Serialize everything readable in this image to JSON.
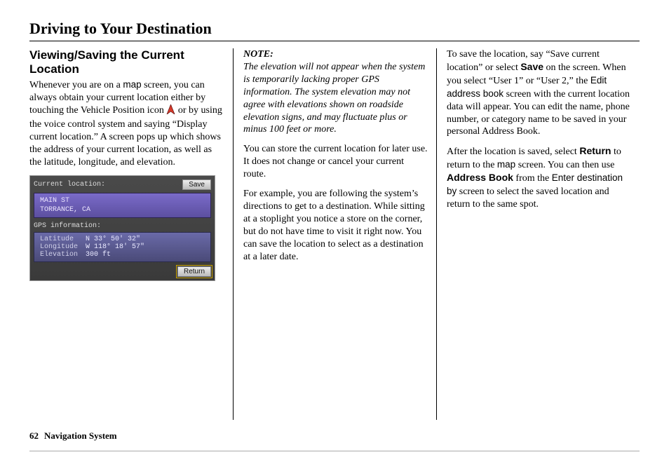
{
  "chapter_title": "Driving to Your Destination",
  "col1": {
    "section_title": "Viewing/Saving the Current Location",
    "para1_pre": "Whenever you are on a ",
    "map_word": "map",
    "para1_mid": " screen, you can always obtain your current location either by touching the Vehicle Position icon ",
    "para1_post": " or by using the voice control system and saying “Display current location.” A screen pops up which shows the address of your current location, as well as the latitude, longitude, and elevation."
  },
  "gps": {
    "header_label": "Current location:",
    "save_btn": "Save",
    "address_line1": "MAIN ST",
    "address_line2": "TORRANCE, CA",
    "info_label": "GPS information:",
    "lat_key": "Latitude",
    "lat_val": "N 33° 50' 32\"",
    "lon_key": "Longitude",
    "lon_val": "W 118° 18' 57\"",
    "elev_key": "Elevation",
    "elev_val": "300 ft",
    "return_btn": "Return"
  },
  "col2": {
    "note_h": "NOTE:",
    "note_body": "The elevation will not appear when the system is temporarily lacking proper GPS information. The system elevation may not agree with elevations shown on roadside elevation signs, and may fluctuate plus or minus 100 feet or more.",
    "p2": "You can store the current location for later use. It does not change or cancel your current route.",
    "p3": "For example, you are following the system’s directions to get to a destination. While sitting at a stoplight you notice a store on the corner, but do not have time to visit it right now. You can save the location to select as a destination at a later date."
  },
  "col3": {
    "p1_a": "To save the location, say “Save current location” or select ",
    "p1_save": "Save",
    "p1_b": " on the screen. When you select “User 1” or “User 2,” the ",
    "p1_edit": "Edit address book",
    "p1_c": " screen with the current location data will appear. You can edit the name, phone number, or category name to be saved in your personal Address Book.",
    "p2_a": "After the location is saved, select ",
    "p2_return": "Return",
    "p2_b": " to return to the ",
    "p2_map": "map",
    "p2_c": " screen. You can then use ",
    "p2_ab": "Address Book",
    "p2_d": " from the ",
    "p2_enter": "Enter destination by",
    "p2_e": " screen to select the saved location and return to the same spot."
  },
  "footer": {
    "page": "62",
    "book": "Navigation System"
  }
}
